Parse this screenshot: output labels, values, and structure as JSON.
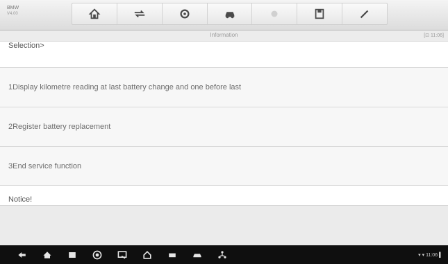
{
  "brand": {
    "name": "BMW",
    "model": "V4.00"
  },
  "toolbar": {
    "buttons": [
      {
        "icon": "home-icon"
      },
      {
        "icon": "vehicle-swap-icon"
      },
      {
        "icon": "settings-icon"
      },
      {
        "icon": "car-icon"
      },
      {
        "icon": "record-icon"
      },
      {
        "icon": "save-icon"
      },
      {
        "icon": "pen-icon"
      }
    ]
  },
  "subheader": {
    "title": "Information",
    "status": "[⊡ 11:06]"
  },
  "content": {
    "selection": "Selection>",
    "options": [
      "1Display kilometre reading at last battery change and one before last",
      "2Register battery replacement",
      "3End service function"
    ],
    "notice": "Notice!"
  },
  "navbar": {
    "status": "▾ ▾ 11:06 ▌",
    "icons": [
      "back-icon",
      "home-icon",
      "recent-apps-icon",
      "chrome-icon",
      "screen-icon",
      "home-alt-icon",
      "car-scan-icon",
      "dtc-icon",
      "network-icon"
    ]
  }
}
